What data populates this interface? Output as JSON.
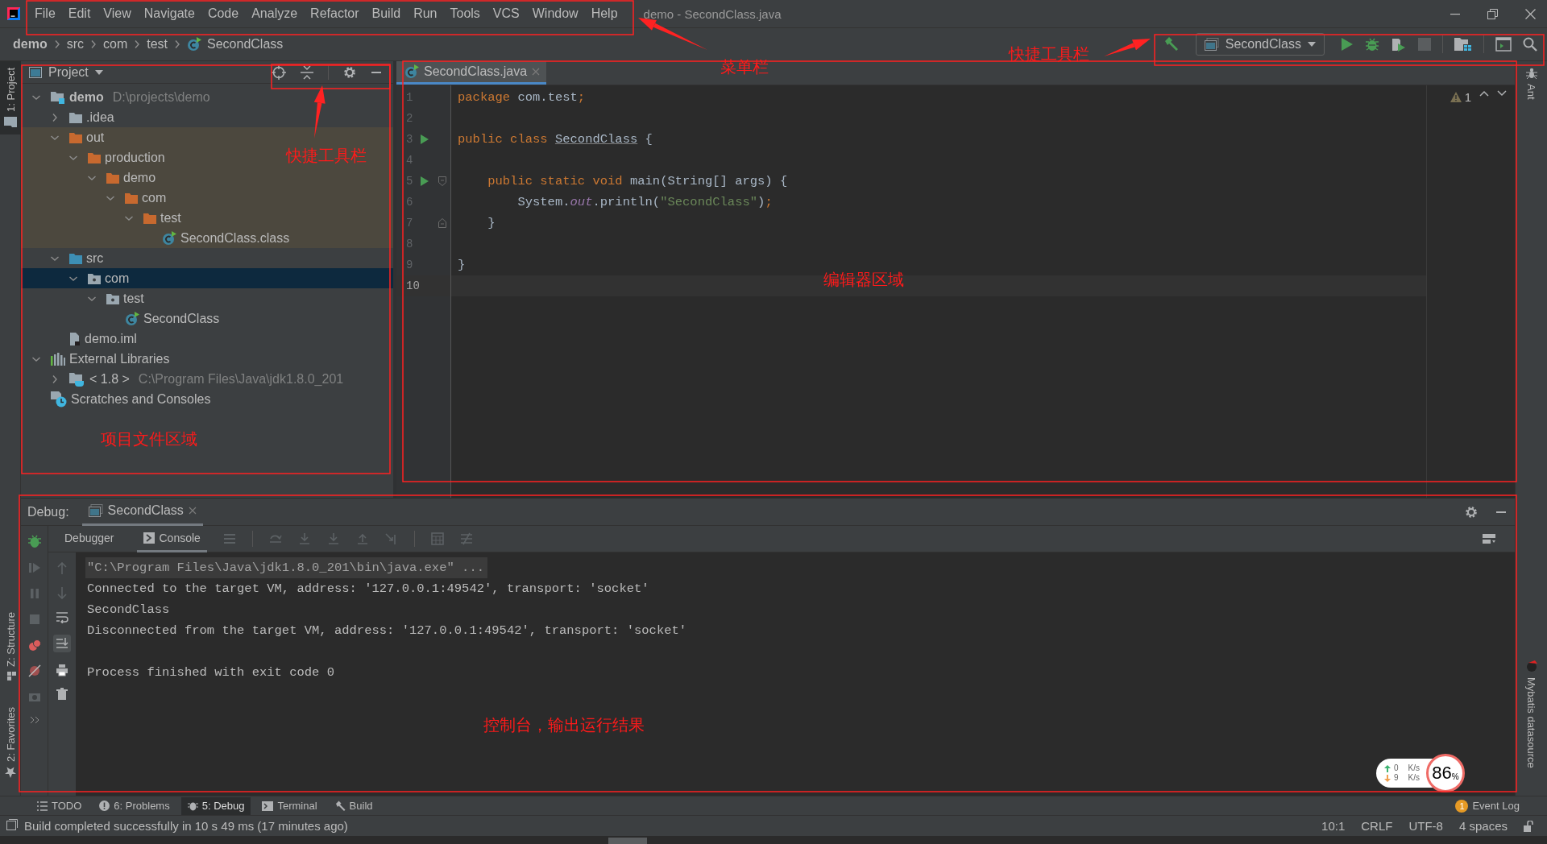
{
  "window": {
    "title": "demo - SecondClass.java"
  },
  "menu": [
    "File",
    "Edit",
    "View",
    "Navigate",
    "Code",
    "Analyze",
    "Refactor",
    "Build",
    "Run",
    "Tools",
    "VCS",
    "Window",
    "Help"
  ],
  "breadcrumb": [
    {
      "label": "demo",
      "kind": "module"
    },
    {
      "label": "src",
      "kind": "folder"
    },
    {
      "label": "com",
      "kind": "folder"
    },
    {
      "label": "test",
      "kind": "folder"
    },
    {
      "label": "SecondClass",
      "kind": "class"
    }
  ],
  "toolbar": {
    "run_config": "SecondClass"
  },
  "left_stripe": [
    {
      "label": "1: Project",
      "selected": true
    },
    {
      "label": "Z: Structure",
      "selected": false
    },
    {
      "label": "2: Favorites",
      "selected": false
    }
  ],
  "right_stripe": [
    "Ant",
    "Mybatis datasource"
  ],
  "project": {
    "title": "Project",
    "tree": [
      {
        "label": "demo",
        "detail": "D:\\projects\\demo",
        "kind": "module",
        "expanded": true,
        "selected": false,
        "children": [
          {
            "label": ".idea",
            "kind": "folder",
            "expanded": false,
            "selected": false
          },
          {
            "label": "out",
            "kind": "excluded-folder",
            "expanded": true,
            "selected": false,
            "children": [
              {
                "label": "production",
                "kind": "excluded-folder",
                "expanded": true,
                "selected": false,
                "children": [
                  {
                    "label": "demo",
                    "kind": "excluded-folder",
                    "expanded": true,
                    "selected": false,
                    "children": [
                      {
                        "label": "com",
                        "kind": "excluded-folder",
                        "expanded": true,
                        "selected": false,
                        "children": [
                          {
                            "label": "test",
                            "kind": "excluded-folder",
                            "expanded": true,
                            "selected": false,
                            "children": [
                              {
                                "label": "SecondClass.class",
                                "kind": "compiled-class",
                                "selected": false
                              }
                            ]
                          }
                        ]
                      }
                    ]
                  }
                ]
              }
            ]
          },
          {
            "label": "src",
            "kind": "source-folder",
            "expanded": true,
            "selected": false,
            "children": [
              {
                "label": "com",
                "kind": "package",
                "expanded": true,
                "selected": true,
                "children": [
                  {
                    "label": "test",
                    "kind": "package",
                    "expanded": true,
                    "selected": false,
                    "children": [
                      {
                        "label": "SecondClass",
                        "kind": "class",
                        "selected": false
                      }
                    ]
                  }
                ]
              }
            ]
          },
          {
            "label": "demo.iml",
            "kind": "file",
            "selected": false
          }
        ]
      },
      {
        "label": "External Libraries",
        "kind": "libraries",
        "expanded": true,
        "selected": false,
        "children": [
          {
            "label": "< 1.8 >",
            "detail": "C:\\Program Files\\Java\\jdk1.8.0_201",
            "kind": "sdk",
            "expanded": false,
            "selected": false
          }
        ]
      },
      {
        "label": "Scratches and Consoles",
        "kind": "scratches",
        "selected": false
      }
    ]
  },
  "editor": {
    "tabs": [
      {
        "label": "SecondClass.java",
        "selected": true
      }
    ],
    "warnings": "1",
    "lines": [
      {
        "number": "1",
        "current": false,
        "tokens": [
          {
            "text": "package ",
            "kind": "keyword"
          },
          {
            "text": "com.test",
            "kind": "plain"
          },
          {
            "text": ";",
            "kind": "punct"
          }
        ]
      },
      {
        "number": "2",
        "current": false
      },
      {
        "number": "3",
        "current": false,
        "run_marker": true,
        "tokens": [
          {
            "text": "public class ",
            "kind": "keyword"
          },
          {
            "text": "SecondClass",
            "kind": "declaration"
          },
          {
            "text": " {",
            "kind": "plain"
          }
        ]
      },
      {
        "number": "4",
        "current": false
      },
      {
        "number": "5",
        "current": false,
        "run_marker": true,
        "fold_start": true,
        "tokens": [
          {
            "text": "    public static void ",
            "kind": "keyword"
          },
          {
            "text": "main(String[] args) {",
            "kind": "plain"
          }
        ]
      },
      {
        "number": "6",
        "current": false,
        "tokens": [
          {
            "text": "        System.",
            "kind": "plain"
          },
          {
            "text": "out",
            "kind": "field"
          },
          {
            "text": ".println(",
            "kind": "plain"
          },
          {
            "text": "\"SecondClass\"",
            "kind": "string"
          },
          {
            "text": ")",
            "kind": "plain"
          },
          {
            "text": ";",
            "kind": "punct"
          }
        ]
      },
      {
        "number": "7",
        "current": false,
        "fold_end": true,
        "tokens": [
          {
            "text": "    }",
            "kind": "plain"
          }
        ]
      },
      {
        "number": "8",
        "current": false
      },
      {
        "number": "9",
        "current": false,
        "tokens": [
          {
            "text": "}",
            "kind": "plain"
          }
        ]
      },
      {
        "number": "10",
        "current": true
      }
    ]
  },
  "debug": {
    "title": "Debug:",
    "tabs": [
      {
        "label": "SecondClass",
        "selected": true
      }
    ],
    "subtabs": [
      {
        "label": "Debugger",
        "selected": false
      },
      {
        "label": "Console",
        "selected": true
      }
    ],
    "console": [
      {
        "text": "\"C:\\Program Files\\Java\\jdk1.8.0_201\\bin\\java.exe\" ...",
        "kind": "command"
      },
      {
        "text": "Connected to the target VM, address: '127.0.0.1:49542', transport: 'socket'",
        "kind": "output"
      },
      {
        "text": "SecondClass",
        "kind": "output"
      },
      {
        "text": "Disconnected from the target VM, address: '127.0.0.1:49542', transport: 'socket'",
        "kind": "output"
      },
      {
        "text": "Process finished with exit code 0",
        "kind": "exit"
      }
    ]
  },
  "network_widget": {
    "upload": {
      "value": "0",
      "unit": "K/s"
    },
    "download": {
      "value": "9",
      "unit": "K/s"
    },
    "percent": "86",
    "percent_sign": "%"
  },
  "tool_tabs": [
    {
      "label": "TODO",
      "kind": "todo",
      "selected": false
    },
    {
      "label": "6: Problems",
      "kind": "problems",
      "selected": false
    },
    {
      "label": "5: Debug",
      "kind": "debug",
      "selected": true
    },
    {
      "label": "Terminal",
      "kind": "terminal",
      "selected": false
    },
    {
      "label": "Build",
      "kind": "build",
      "selected": false
    }
  ],
  "event_log": {
    "label": "Event Log",
    "count": "1"
  },
  "status": {
    "message": "Build completed successfully in 10 s 49 ms (17 minutes ago)",
    "items": [
      "10:1",
      "CRLF",
      "UTF-8",
      "4 spaces"
    ]
  },
  "annotations": [
    "菜单栏",
    "快捷工具栏",
    "快捷工具栏",
    "编辑器区域",
    "项目文件区域",
    "控制台，输出运行结果"
  ]
}
